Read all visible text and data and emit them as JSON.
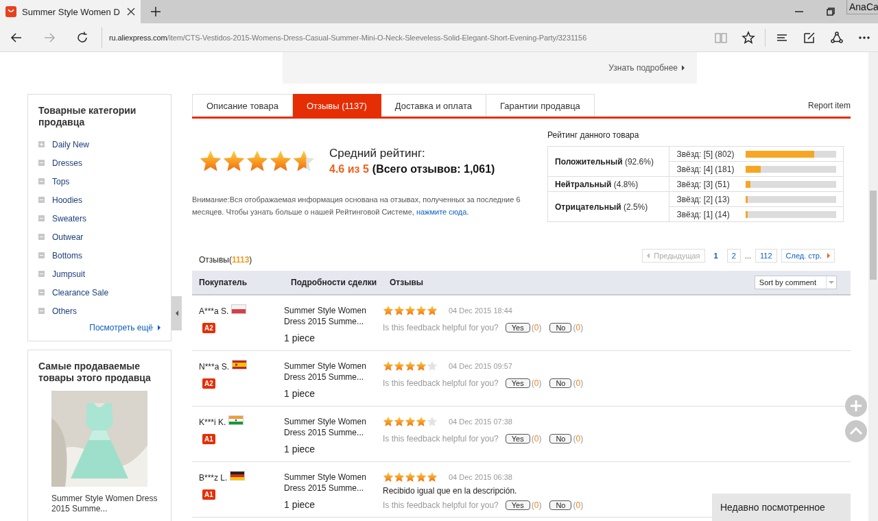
{
  "browser": {
    "tab_title": "Summer Style Women D",
    "corner_label": "AnaCa",
    "url_host": "ru.aliexpress.com",
    "url_path": "/item/CTS-Vestidos-2015-Womens-Dress-Casual-Summer-Mini-O-Neck-Sleeveless-Solid-Elegant-Short-Evening-Party/3231156"
  },
  "promo": {
    "link": "Узнать подробнее"
  },
  "sidebar": {
    "title": "Товарные категории продавца",
    "categories": [
      {
        "label": "Daily New",
        "expanded": false
      },
      {
        "label": "Dresses",
        "expanded": true
      },
      {
        "label": "Tops",
        "expanded": true
      },
      {
        "label": "Hoodies",
        "expanded": true
      },
      {
        "label": "Sweaters",
        "expanded": true
      },
      {
        "label": "Outwear",
        "expanded": true
      },
      {
        "label": "Bottoms",
        "expanded": true
      },
      {
        "label": "Jumpsuit",
        "expanded": true
      },
      {
        "label": "Clearance Sale",
        "expanded": true
      },
      {
        "label": "Others",
        "expanded": true
      }
    ],
    "more": "Посмотреть ещё",
    "bestsellers_title": "Самые продаваемые товары этого продавца",
    "bestseller": {
      "kind": "picture",
      "title": "Summer Style Women Dress 2015 Summe..."
    }
  },
  "tabs": [
    {
      "label": "Описание товара",
      "selected": false
    },
    {
      "label": "Отзывы (1137)",
      "selected": true
    },
    {
      "label": "Доставка и оплата",
      "selected": false
    },
    {
      "label": "Гарантии продавца",
      "selected": false
    }
  ],
  "report": "Report item",
  "summary": {
    "stars": 4.6,
    "avg_label": "Средний рейтинг:",
    "score": "4.6 из 5",
    "total": "(Всего отзывов: 1,061)",
    "note": "Внимание:Вся отображаемая информация основана на отзывах, полученных за последние 6 месяцев. Чтобы узнать больше о нашей Рейтинговой Системе,",
    "note_link": "нажмите сюда."
  },
  "rating_table": {
    "title": "Рейтинг данного товара",
    "groups": [
      {
        "name": "Положительный",
        "percent": "(92.6%)",
        "rows": [
          {
            "label": "Звёзд: [5] (802)",
            "level": 0.76
          },
          {
            "label": "Звёзд: [4] (181)",
            "level": 0.17
          }
        ]
      },
      {
        "name": "Нейтральный",
        "percent": "(4.8%)",
        "rows": [
          {
            "label": "Звёзд: [3] (51)",
            "level": 0.05
          }
        ]
      },
      {
        "name": "Отрицательный",
        "percent": "(2.5%)",
        "rows": [
          {
            "label": "Звёзд: [2] (13)",
            "level": 0.02
          },
          {
            "label": "Звёзд: [1] (14)",
            "level": 0.02
          }
        ]
      }
    ]
  },
  "reviews": {
    "label": "Отзывы(**1113**)",
    "pagination": [
      {
        "label": "Предыдущая",
        "kind": "prev",
        "disabled": true
      },
      {
        "label": "1",
        "kind": "page",
        "selected": true
      },
      {
        "label": "2",
        "kind": "page",
        "selected": false
      },
      {
        "label": "...",
        "kind": "gap"
      },
      {
        "label": "112",
        "kind": "page",
        "selected": false
      },
      {
        "label": "След. стр.",
        "kind": "next",
        "disabled": false
      }
    ],
    "columns": [
      "Покупатель",
      "Подробности сделки",
      "Отзывы"
    ],
    "sort": "Sort by comment",
    "rows": [
      {
        "buyer": "A***a S.",
        "flag": {
          "kind": "pl"
        },
        "level_badge": "A2",
        "product": "Summer Style Women Dress 2015 Summe...",
        "qty": "1 piece",
        "stars": 5,
        "date": "04 Dec 2015 18:44",
        "helpful": "Is this feedback helpful for you?",
        "yes": "Yes",
        "yes_count": "(**0**)",
        "no": "No",
        "no_count": "(**0**)"
      },
      {
        "buyer": "N***a S.",
        "flag": {
          "kind": "es"
        },
        "level_badge": "A2",
        "product": "Summer Style Women Dress 2015 Summe...",
        "qty": "1 piece",
        "stars": 4,
        "date": "04 Dec 2015 09:57",
        "helpful": "Is this feedback helpful for you?",
        "yes": "Yes",
        "yes_count": "(**0**)",
        "no": "No",
        "no_count": "(**0**)"
      },
      {
        "buyer": "K***i K.",
        "flag": {
          "kind": "in"
        },
        "level_badge": "A1",
        "product": "Summer Style Women Dress 2015 Summe...",
        "qty": "1 piece",
        "stars": 4,
        "date": "04 Dec 2015 07:38",
        "helpful": "Is this feedback helpful for you?",
        "yes": "Yes",
        "yes_count": "(**0**)",
        "no": "No",
        "no_count": "(**0**)"
      },
      {
        "buyer": "B***z L.",
        "flag": {
          "kind": "de"
        },
        "level_badge": "A1",
        "product": "Summer Style Women Dress 2015 Summe...",
        "qty": "1 piece",
        "stars": 5,
        "date": "04 Dec 2015 06:38",
        "comment": "Recibido igual que en la descripción.",
        "helpful": "Is this feedback helpful for you?",
        "yes": "Yes",
        "yes_count": "(**0**)",
        "no": "No",
        "no_count": "(**0**)"
      }
    ]
  },
  "recently_viewed": "Недавно посмотренное"
}
